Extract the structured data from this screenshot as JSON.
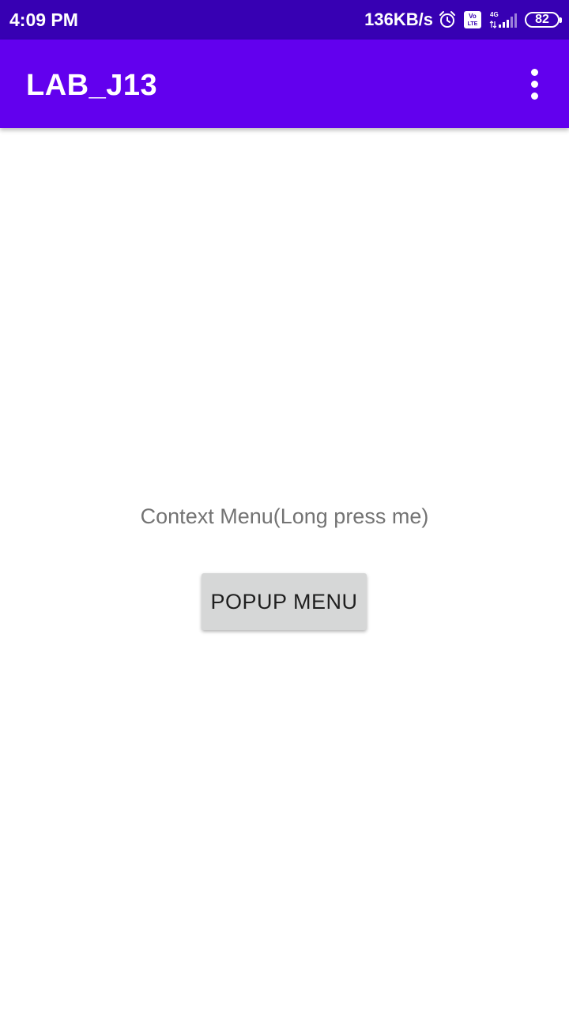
{
  "status_bar": {
    "time": "4:09 PM",
    "network_speed": "136KB/s",
    "icons": [
      "alarm-icon",
      "volte-icon",
      "signal-4g-icon"
    ],
    "volte_label": "Vo LTE",
    "network_type": "4G",
    "battery_level": "82",
    "background_color": "#3700b3"
  },
  "app_bar": {
    "title": "LAB_J13",
    "overflow_icon": "more-vert-icon",
    "background_color": "#6200ee"
  },
  "content": {
    "context_menu_text": "Context Menu(Long press me)",
    "popup_button_label": "POPUP MENU"
  }
}
